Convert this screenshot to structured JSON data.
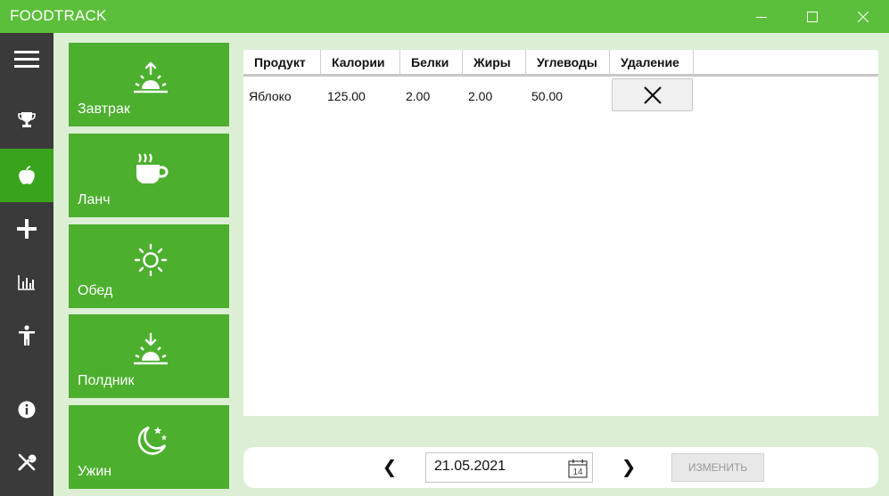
{
  "app": {
    "title": "FOODTRACK"
  },
  "window_controls": [
    "minimize-icon",
    "maximize-icon",
    "close-icon"
  ],
  "nav": {
    "items": [
      {
        "icon": "menu-icon"
      },
      {
        "icon": "trophy-icon"
      },
      {
        "icon": "apple-icon",
        "active": true
      },
      {
        "icon": "plus-icon"
      },
      {
        "icon": "bar-chart-icon"
      },
      {
        "icon": "person-icon"
      },
      {
        "icon": "info-icon"
      },
      {
        "icon": "tools-icon"
      }
    ]
  },
  "meals": [
    {
      "label": "Завтрак",
      "icon": "sunrise-icon"
    },
    {
      "label": "Ланч",
      "icon": "coffee-cup-icon"
    },
    {
      "label": "Обед",
      "icon": "sun-icon"
    },
    {
      "label": "Полдник",
      "icon": "sunset-icon"
    },
    {
      "label": "Ужин",
      "icon": "moon-stars-icon"
    }
  ],
  "table": {
    "columns": [
      "Продукт",
      "Калории",
      "Белки",
      "Жиры",
      "Углеводы",
      "Удаление"
    ],
    "rows": [
      {
        "product": "Яблоко",
        "calories": "125.00",
        "protein": "2.00",
        "fat": "2.00",
        "carbs": "50.00",
        "delete_icon": "close-icon"
      }
    ]
  },
  "footer": {
    "prev": "❮",
    "next": "❯",
    "date": "21.05.2021",
    "calendar_icon": "calendar-icon",
    "calendar_day": "14",
    "change_label": "ИЗМЕНИТЬ"
  },
  "colors": {
    "brand": "#5cbf3b",
    "tile": "#4caf2e",
    "nav_bg": "#3a3a3a",
    "nav_active": "#39a41b",
    "content_bg": "#dcefd5"
  }
}
